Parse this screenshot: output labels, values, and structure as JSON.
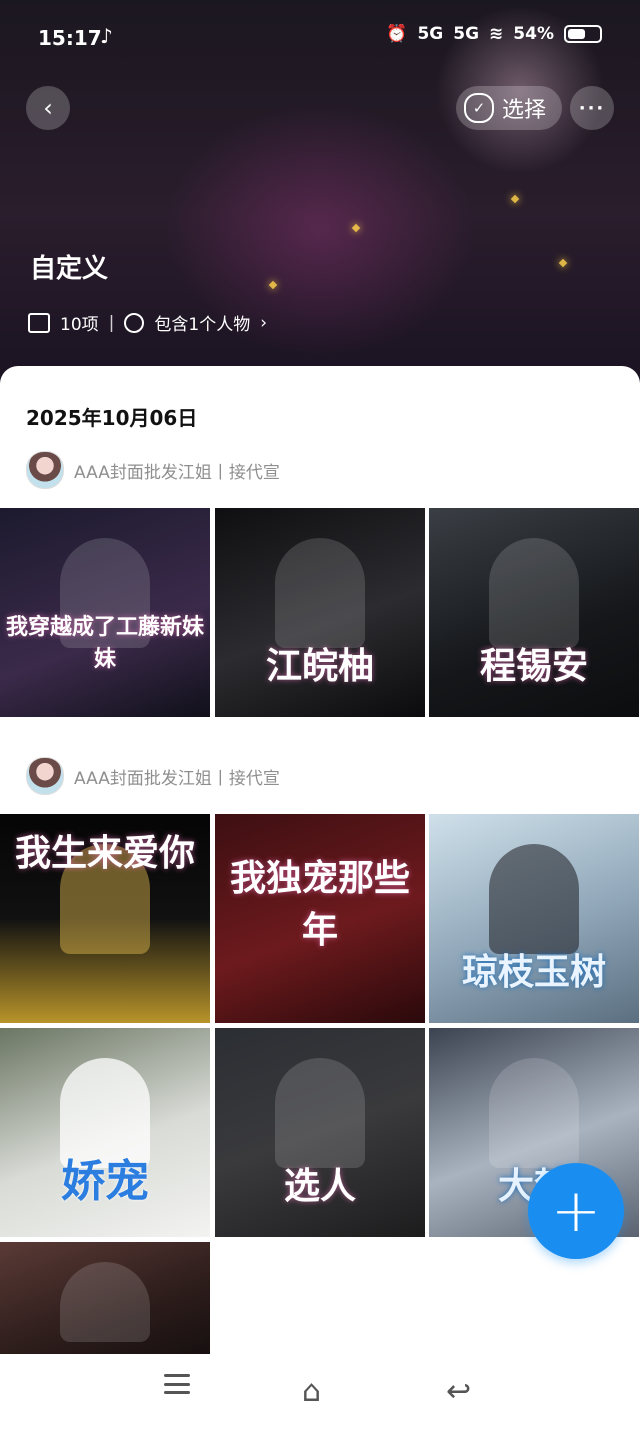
{
  "status_bar": {
    "time": "15:17",
    "tiktok_icon": "♪",
    "signal1": "5G",
    "signal2": "5G",
    "battery": "54%"
  },
  "toolbar": {
    "back_icon": "‹",
    "select_label": "选择",
    "more_icon": "···"
  },
  "album": {
    "title": "自定义",
    "count": "10项",
    "people": "包含1个人物",
    "people_chevron": "›",
    "meta_sep": "|"
  },
  "content": {
    "date": "2025年10月06日",
    "groups": [
      {
        "owner": "AAA封面批发江姐丨接代宣",
        "photos": [
          {
            "caption": "我穿越成了工藤新妹妹"
          },
          {
            "caption": "江皖柚"
          },
          {
            "caption": "程锡安"
          }
        ]
      },
      {
        "owner": "AAA封面批发江姐丨接代宣",
        "photos": [
          {
            "caption": "我生来爱你"
          },
          {
            "caption": "我独宠那些年"
          },
          {
            "caption": "琼枝玉树"
          },
          {
            "caption": "娇宠"
          },
          {
            "caption": "选人"
          },
          {
            "caption": "大梦"
          },
          {
            "caption": ""
          }
        ]
      }
    ]
  },
  "fab": {
    "icon": "+"
  },
  "colors": {
    "accent": "#1a8ef0",
    "muted_text": "#8f8f8f",
    "header_bg": "#1b1720"
  }
}
